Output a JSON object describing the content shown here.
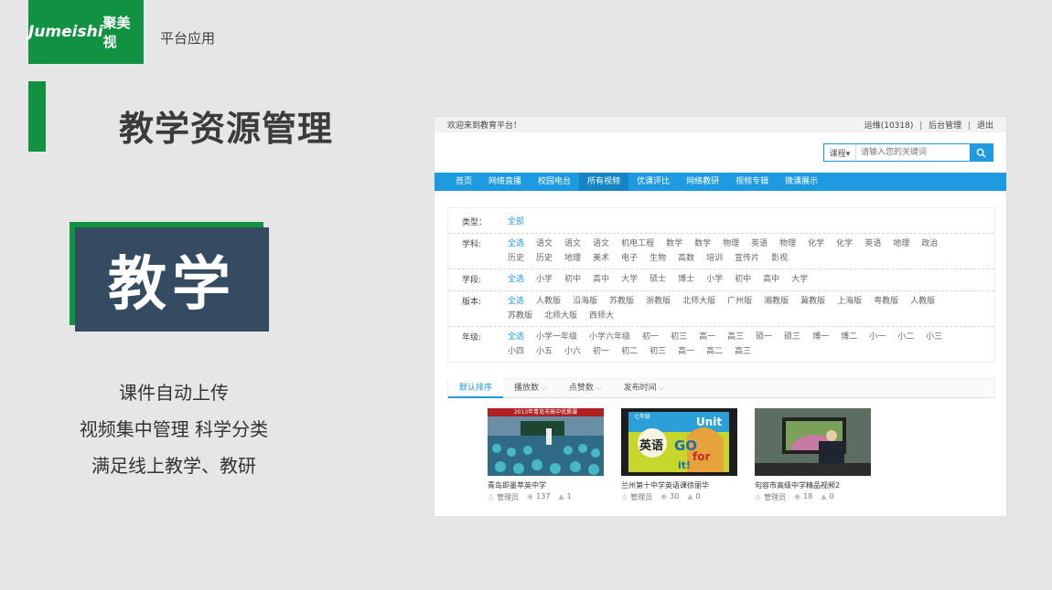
{
  "slide": {
    "logo_latin": "Jumeishi",
    "logo_cn": "聚美视",
    "breadcrumb": "平台应用",
    "title": "教学资源管理",
    "badge": "教学",
    "features": [
      "课件自动上传",
      "视频集中管理 科学分类",
      "满足线上教学、教研"
    ]
  },
  "site": {
    "welcome": "欢迎来到教育平台！",
    "user": "运维(10318)",
    "admin_link": "后台管理",
    "logout_link": "退出",
    "search": {
      "type_label": "课程▾",
      "placeholder": "请输入您的关键词"
    },
    "nav": [
      {
        "label": "首页",
        "active": false
      },
      {
        "label": "网络直播",
        "active": false
      },
      {
        "label": "校园电台",
        "active": false
      },
      {
        "label": "所有视频",
        "active": true
      },
      {
        "label": "优课评比",
        "active": false
      },
      {
        "label": "网络教研",
        "active": false
      },
      {
        "label": "视频专辑",
        "active": false
      },
      {
        "label": "微课展示",
        "active": false
      }
    ],
    "filters": [
      {
        "label": "类型：",
        "options": [
          "全部"
        ]
      },
      {
        "label": "学科:",
        "options": [
          "全选",
          "语文",
          "语文",
          "语文",
          "机电工程",
          "数学",
          "数学",
          "物理",
          "英语",
          "物理",
          "化学",
          "化学",
          "英语",
          "地理",
          "政治",
          "历史",
          "历史",
          "地理",
          "美术",
          "电子",
          "生物",
          "高数",
          "培训",
          "宣传片",
          "影视"
        ]
      },
      {
        "label": "学段:",
        "options": [
          "全选",
          "小学",
          "初中",
          "高中",
          "大学",
          "硕士",
          "博士",
          "小学",
          "初中",
          "高中",
          "大学"
        ]
      },
      {
        "label": "版本:",
        "options": [
          "全选",
          "人教版",
          "沿海版",
          "苏教版",
          "浙教版",
          "北师大版",
          "广州版",
          "湘教版",
          "冀教版",
          "上海版",
          "粤教版",
          "人教版",
          "苏教版",
          "北师大版",
          "西师大"
        ]
      },
      {
        "label": "年级:",
        "options": [
          "全选",
          "小学一年级",
          "小学六年级",
          "初一",
          "初三",
          "高一",
          "高三",
          "硕一",
          "硕三",
          "博一",
          "博二",
          "小一",
          "小二",
          "小三",
          "小四",
          "小五",
          "小六",
          "初一",
          "初二",
          "初三",
          "高一",
          "高二",
          "高三"
        ]
      }
    ],
    "sort": [
      {
        "label": "默认排序",
        "active": true
      },
      {
        "label": "播放数",
        "active": false
      },
      {
        "label": "点赞数",
        "active": false
      },
      {
        "label": "发布时间",
        "active": false
      }
    ],
    "videos": [
      {
        "title": "青岛即墨萃英中学",
        "author": "管理员",
        "views": "137",
        "likes": "1",
        "thumb": "classroom"
      },
      {
        "title": "兰州第十中学英语课徐丽华",
        "author": "管理员",
        "views": "30",
        "likes": "0",
        "thumb": "book"
      },
      {
        "title": "句容市高级中学精品视频2",
        "author": "管理员",
        "views": "18",
        "likes": "0",
        "thumb": "teacher"
      }
    ],
    "thumb_texts": {
      "banner": "2013年青岛市高中优质课",
      "grade": "七年级",
      "subject": "英语",
      "unit": "Unit",
      "go": "GO",
      "for": "for",
      "it": "it!"
    },
    "colors": {
      "brand_green": "#119142",
      "site_blue": "#1e9ae0",
      "badge_navy": "#344b62"
    }
  }
}
